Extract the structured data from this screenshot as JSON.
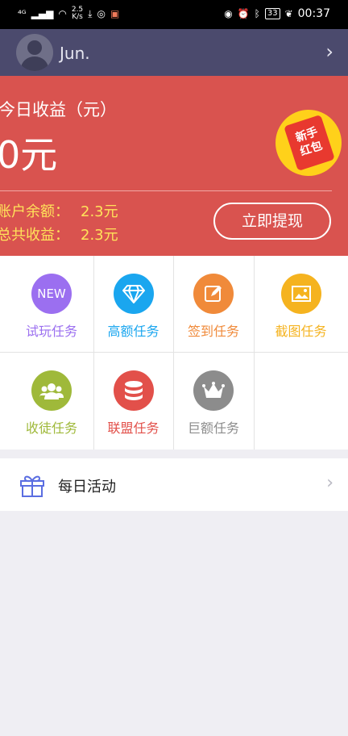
{
  "status_bar": {
    "network": "⁴ᴳ",
    "speed_value": "2.5",
    "speed_unit": "K/s",
    "battery": "33",
    "time": "00:37"
  },
  "profile": {
    "username": "Jun."
  },
  "earnings": {
    "today_label": "今日收益（元）",
    "today_value": "0元",
    "redpack_line1": "新手",
    "redpack_line2": "红包",
    "balance_label": "账户余额：",
    "balance_value": "2.3元",
    "total_label": "总共收益：",
    "total_value": "2.3元",
    "withdraw_label": "立即提现"
  },
  "tasks": [
    {
      "label": "试玩任务",
      "icon": "NEW",
      "color": "#9b6ff0"
    },
    {
      "label": "高额任务",
      "icon": "diamond-icon",
      "color": "#1aa6ef"
    },
    {
      "label": "签到任务",
      "icon": "edit-icon",
      "color": "#f08a3a"
    },
    {
      "label": "截图任务",
      "icon": "image-icon",
      "color": "#f5b31f"
    },
    {
      "label": "收徒任务",
      "icon": "people-icon",
      "color": "#9fb93a"
    },
    {
      "label": "联盟任务",
      "icon": "database-icon",
      "color": "#e2504a"
    },
    {
      "label": "巨额任务",
      "icon": "crown-icon",
      "color": "#8c8c8c"
    }
  ],
  "activity": {
    "label": "每日活动"
  }
}
